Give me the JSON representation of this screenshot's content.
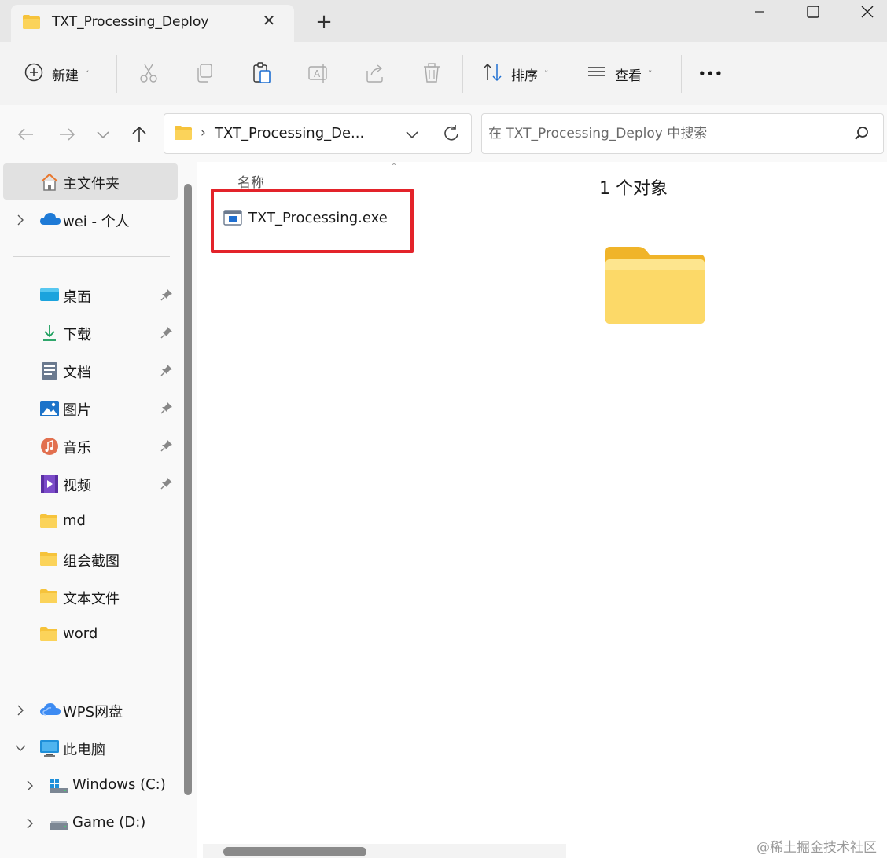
{
  "window": {
    "tab_title": "TXT_Processing_Deploy",
    "tab_close_glyph": "✕",
    "new_tab_glyph": "+"
  },
  "toolbar": {
    "new_label": "新建",
    "sort_label": "排序",
    "view_label": "查看",
    "more_glyph": "•••",
    "chevron_glyph": "˅"
  },
  "address": {
    "separator": "›",
    "path": "TXT_Processing_De...",
    "search_placeholder": "在 TXT_Processing_Deploy 中搜索"
  },
  "sidebar": {
    "items": [
      {
        "label": "主文件夹",
        "icon": "home-icon"
      },
      {
        "label": "wei - 个人",
        "icon": "onedrive-cloud-icon"
      },
      {
        "label": "桌面",
        "icon": "desktop-icon"
      },
      {
        "label": "下载",
        "icon": "download-icon"
      },
      {
        "label": "文档",
        "icon": "document-icon"
      },
      {
        "label": "图片",
        "icon": "pictures-icon"
      },
      {
        "label": "音乐",
        "icon": "music-icon"
      },
      {
        "label": "视频",
        "icon": "video-icon"
      },
      {
        "label": "md",
        "icon": "folder-icon"
      },
      {
        "label": "组会截图",
        "icon": "folder-icon"
      },
      {
        "label": "文本文件",
        "icon": "folder-icon"
      },
      {
        "label": "word",
        "icon": "folder-icon"
      },
      {
        "label": "WPS网盘",
        "icon": "wps-cloud-icon"
      },
      {
        "label": "此电脑",
        "icon": "computer-icon"
      },
      {
        "label": "Windows (C:)",
        "icon": "drive-c-icon"
      },
      {
        "label": "Game (D:)",
        "icon": "drive-d-icon"
      }
    ]
  },
  "main": {
    "column_name": "名称",
    "sort_glyph": "˄",
    "files": [
      {
        "name": "TXT_Processing.exe",
        "icon": "exe-file-icon"
      }
    ]
  },
  "details": {
    "count_label": "1 个对象"
  },
  "watermark": "@稀土掘金技术社区",
  "colors": {
    "highlight": "#e3232a",
    "folder_yellow": "#f6c33b",
    "accent_blue": "#1f6fd1"
  }
}
